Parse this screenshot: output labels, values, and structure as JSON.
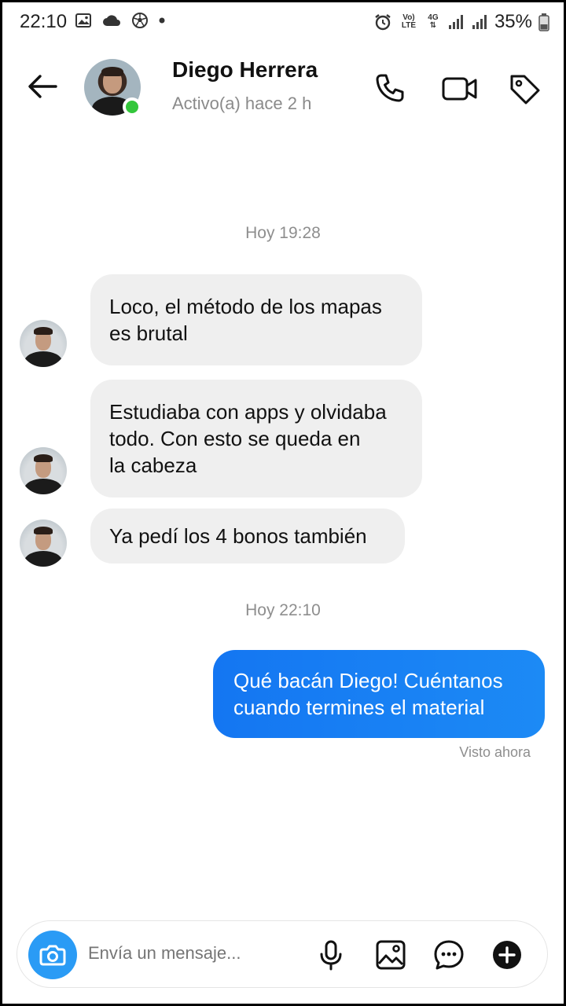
{
  "status_bar": {
    "time": "22:10",
    "battery_percent": "35%",
    "network_label_top": "Vo)",
    "network_label_bottom": "LTE",
    "network_gen": "4G",
    "left_icons": [
      "image-icon",
      "cloud-icon",
      "soccer-ball-icon",
      "dot-icon"
    ],
    "right_icons": [
      "alarm-icon",
      "volte-icon",
      "4g-icon",
      "signal-icon",
      "signal-icon",
      "battery-icon"
    ]
  },
  "header": {
    "contact_name": "Diego Herrera",
    "contact_status": "Activo(a) hace 2 h",
    "online": true,
    "icons": [
      "back-arrow-icon",
      "phone-icon",
      "video-camera-icon",
      "tag-icon"
    ]
  },
  "messages": {
    "timestamp_1": "Hoy 19:28",
    "incoming": [
      {
        "lines": [
          "Loco, el método de los mapas",
          "es brutal"
        ]
      },
      {
        "lines": [
          "Estudiaba con apps y olvidaba",
          "todo. Con esto se queda en",
          "la cabeza"
        ]
      },
      {
        "lines": [
          "Ya pedí los 4 bonos también"
        ]
      }
    ],
    "timestamp_2": "Hoy 22:10",
    "outgoing": [
      {
        "lines": [
          "Qué bacán Diego! Cuéntanos",
          "cuando termines el material"
        ]
      }
    ],
    "seen_label": "Visto ahora"
  },
  "composer": {
    "placeholder": "Envía un mensaje...",
    "icons": [
      "camera-icon",
      "microphone-icon",
      "gallery-icon",
      "sticker-chat-icon",
      "plus-circle-icon"
    ]
  },
  "colors": {
    "outgoing_bubble": "#1877F2",
    "incoming_bubble": "#EFEFEF",
    "online_dot": "#33C63B",
    "camera_button": "#2A9BF5"
  }
}
